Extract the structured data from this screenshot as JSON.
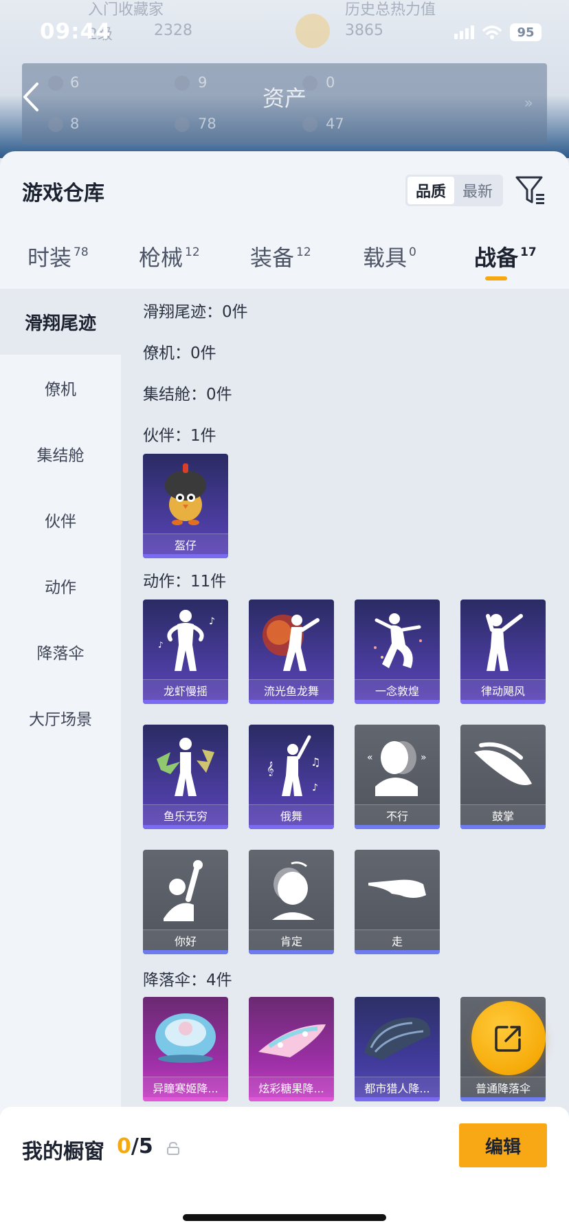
{
  "status_bar": {
    "time": "09:44",
    "battery": "95"
  },
  "background_header": {
    "rows": [
      "入门收藏家",
      "历史总热力值"
    ],
    "level": "2级",
    "points": "2328",
    "heat_value": "3865",
    "stats_row1": [
      "6",
      "9",
      "0"
    ],
    "stats_row2": [
      "8",
      "78",
      "47"
    ]
  },
  "header": {
    "title": "资产"
  },
  "sheet": {
    "title": "游戏仓库",
    "sort_options": [
      "品质",
      "最新"
    ],
    "active_sort": "品质"
  },
  "tabs": [
    {
      "label": "时装",
      "count": "78"
    },
    {
      "label": "枪械",
      "count": "12"
    },
    {
      "label": "装备",
      "count": "12"
    },
    {
      "label": "载具",
      "count": "0"
    },
    {
      "label": "战备",
      "count": "17"
    }
  ],
  "active_tab": "战备",
  "sidebar": {
    "items": [
      "滑翔尾迹",
      "僚机",
      "集结舱",
      "伙伴",
      "动作",
      "降落伞",
      "大厅场景"
    ],
    "active": "滑翔尾迹"
  },
  "sections": {
    "glide": "滑翔尾迹：0件",
    "wingman": "僚机：0件",
    "pod": "集结舱：0件",
    "partner": "伙伴：1件",
    "emote": "动作：11件",
    "parachute": "降落伞：4件"
  },
  "partner_items": [
    {
      "name": "盔仔",
      "icon": "helmet-chick-icon",
      "rarity": "purple"
    }
  ],
  "emote_items": [
    {
      "name": "龙虾慢摇",
      "icon": "dancer-icon",
      "rarity": "purple"
    },
    {
      "name": "流光鱼龙舞",
      "icon": "fire-dancer-icon",
      "rarity": "purple"
    },
    {
      "name": "一念敦煌",
      "icon": "dunhuang-dancer-icon",
      "rarity": "purple"
    },
    {
      "name": "律动飓风",
      "icon": "pose-dancer-icon",
      "rarity": "purple"
    },
    {
      "name": "鱼乐无穷",
      "icon": "splash-dancer-icon",
      "rarity": "purple"
    },
    {
      "name": "俄舞",
      "icon": "music-dancer-icon",
      "rarity": "purple"
    },
    {
      "name": "不行",
      "icon": "head-shake-icon",
      "rarity": "gray"
    },
    {
      "name": "鼓掌",
      "icon": "clap-icon",
      "rarity": "gray"
    },
    {
      "name": "你好",
      "icon": "wave-icon",
      "rarity": "gray"
    },
    {
      "name": "肯定",
      "icon": "nod-icon",
      "rarity": "gray"
    },
    {
      "name": "走",
      "icon": "point-icon",
      "rarity": "gray"
    }
  ],
  "parachute_items": [
    {
      "name": "异瞳寒姬降...",
      "icon": "round-parachute-icon",
      "rarity": "pink"
    },
    {
      "name": "炫彩糖果降...",
      "icon": "candy-parachute-icon",
      "rarity": "pink"
    },
    {
      "name": "都市猎人降...",
      "icon": "urban-parachute-icon",
      "rarity": "darkblue"
    },
    {
      "name": "普通降落伞",
      "icon": "basic-parachute-icon",
      "rarity": "gray"
    }
  ],
  "bottom_bar": {
    "label": "我的橱窗",
    "current": "0",
    "total": "/5",
    "edit_label": "编辑"
  },
  "colors": {
    "accent": "#f5a80f",
    "purple_card": "#4a3c9e",
    "pink_card": "#9a2fa4",
    "gray_card": "#50545d"
  }
}
